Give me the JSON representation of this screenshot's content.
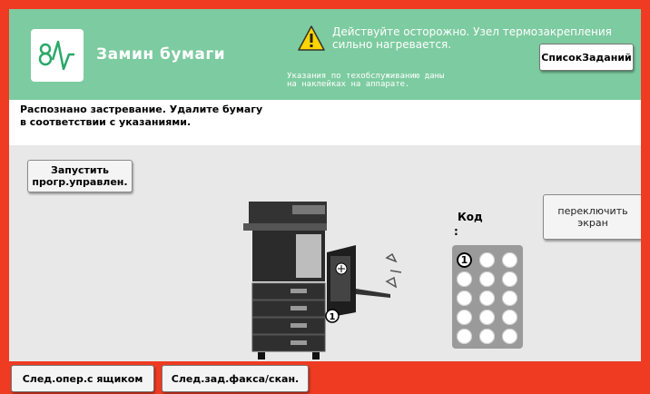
{
  "header": {
    "title": "Замин бумаги",
    "warning_line1": "Действуйте осторожно. Узел термозакрепления",
    "warning_line2": "сильно нагревается.",
    "maintenance_hint_line1": "Указания по техобслуживанию даны",
    "maintenance_hint_line2": "на наклейках на аппарате.",
    "jobs_button": "СписокЗаданий",
    "logo_icon": "jam-wave-logo-icon",
    "warning_icon": "warning-triangle-icon"
  },
  "message": {
    "line1": "Распознано застревание. Удалите бумагу",
    "line2": "в соответствии с указаниями."
  },
  "buttons": {
    "start_line1": "Запустить",
    "start_line2": "прогр.управлен.",
    "switch_line1": "переключить",
    "switch_line2": "экран"
  },
  "code": {
    "label": "Код",
    "colon": ":",
    "first_key": "1"
  },
  "diagram": {
    "jam_marker": "1",
    "hand_icon": "pointing-hand-icon"
  },
  "bottom": {
    "tray_button": "След.опер.с ящиком",
    "fax_button": "След.зад.факса/скан."
  },
  "colors": {
    "header_green": "#7dcba0",
    "frame_red": "#ee3b22",
    "warning_yellow": "#ffd400"
  }
}
